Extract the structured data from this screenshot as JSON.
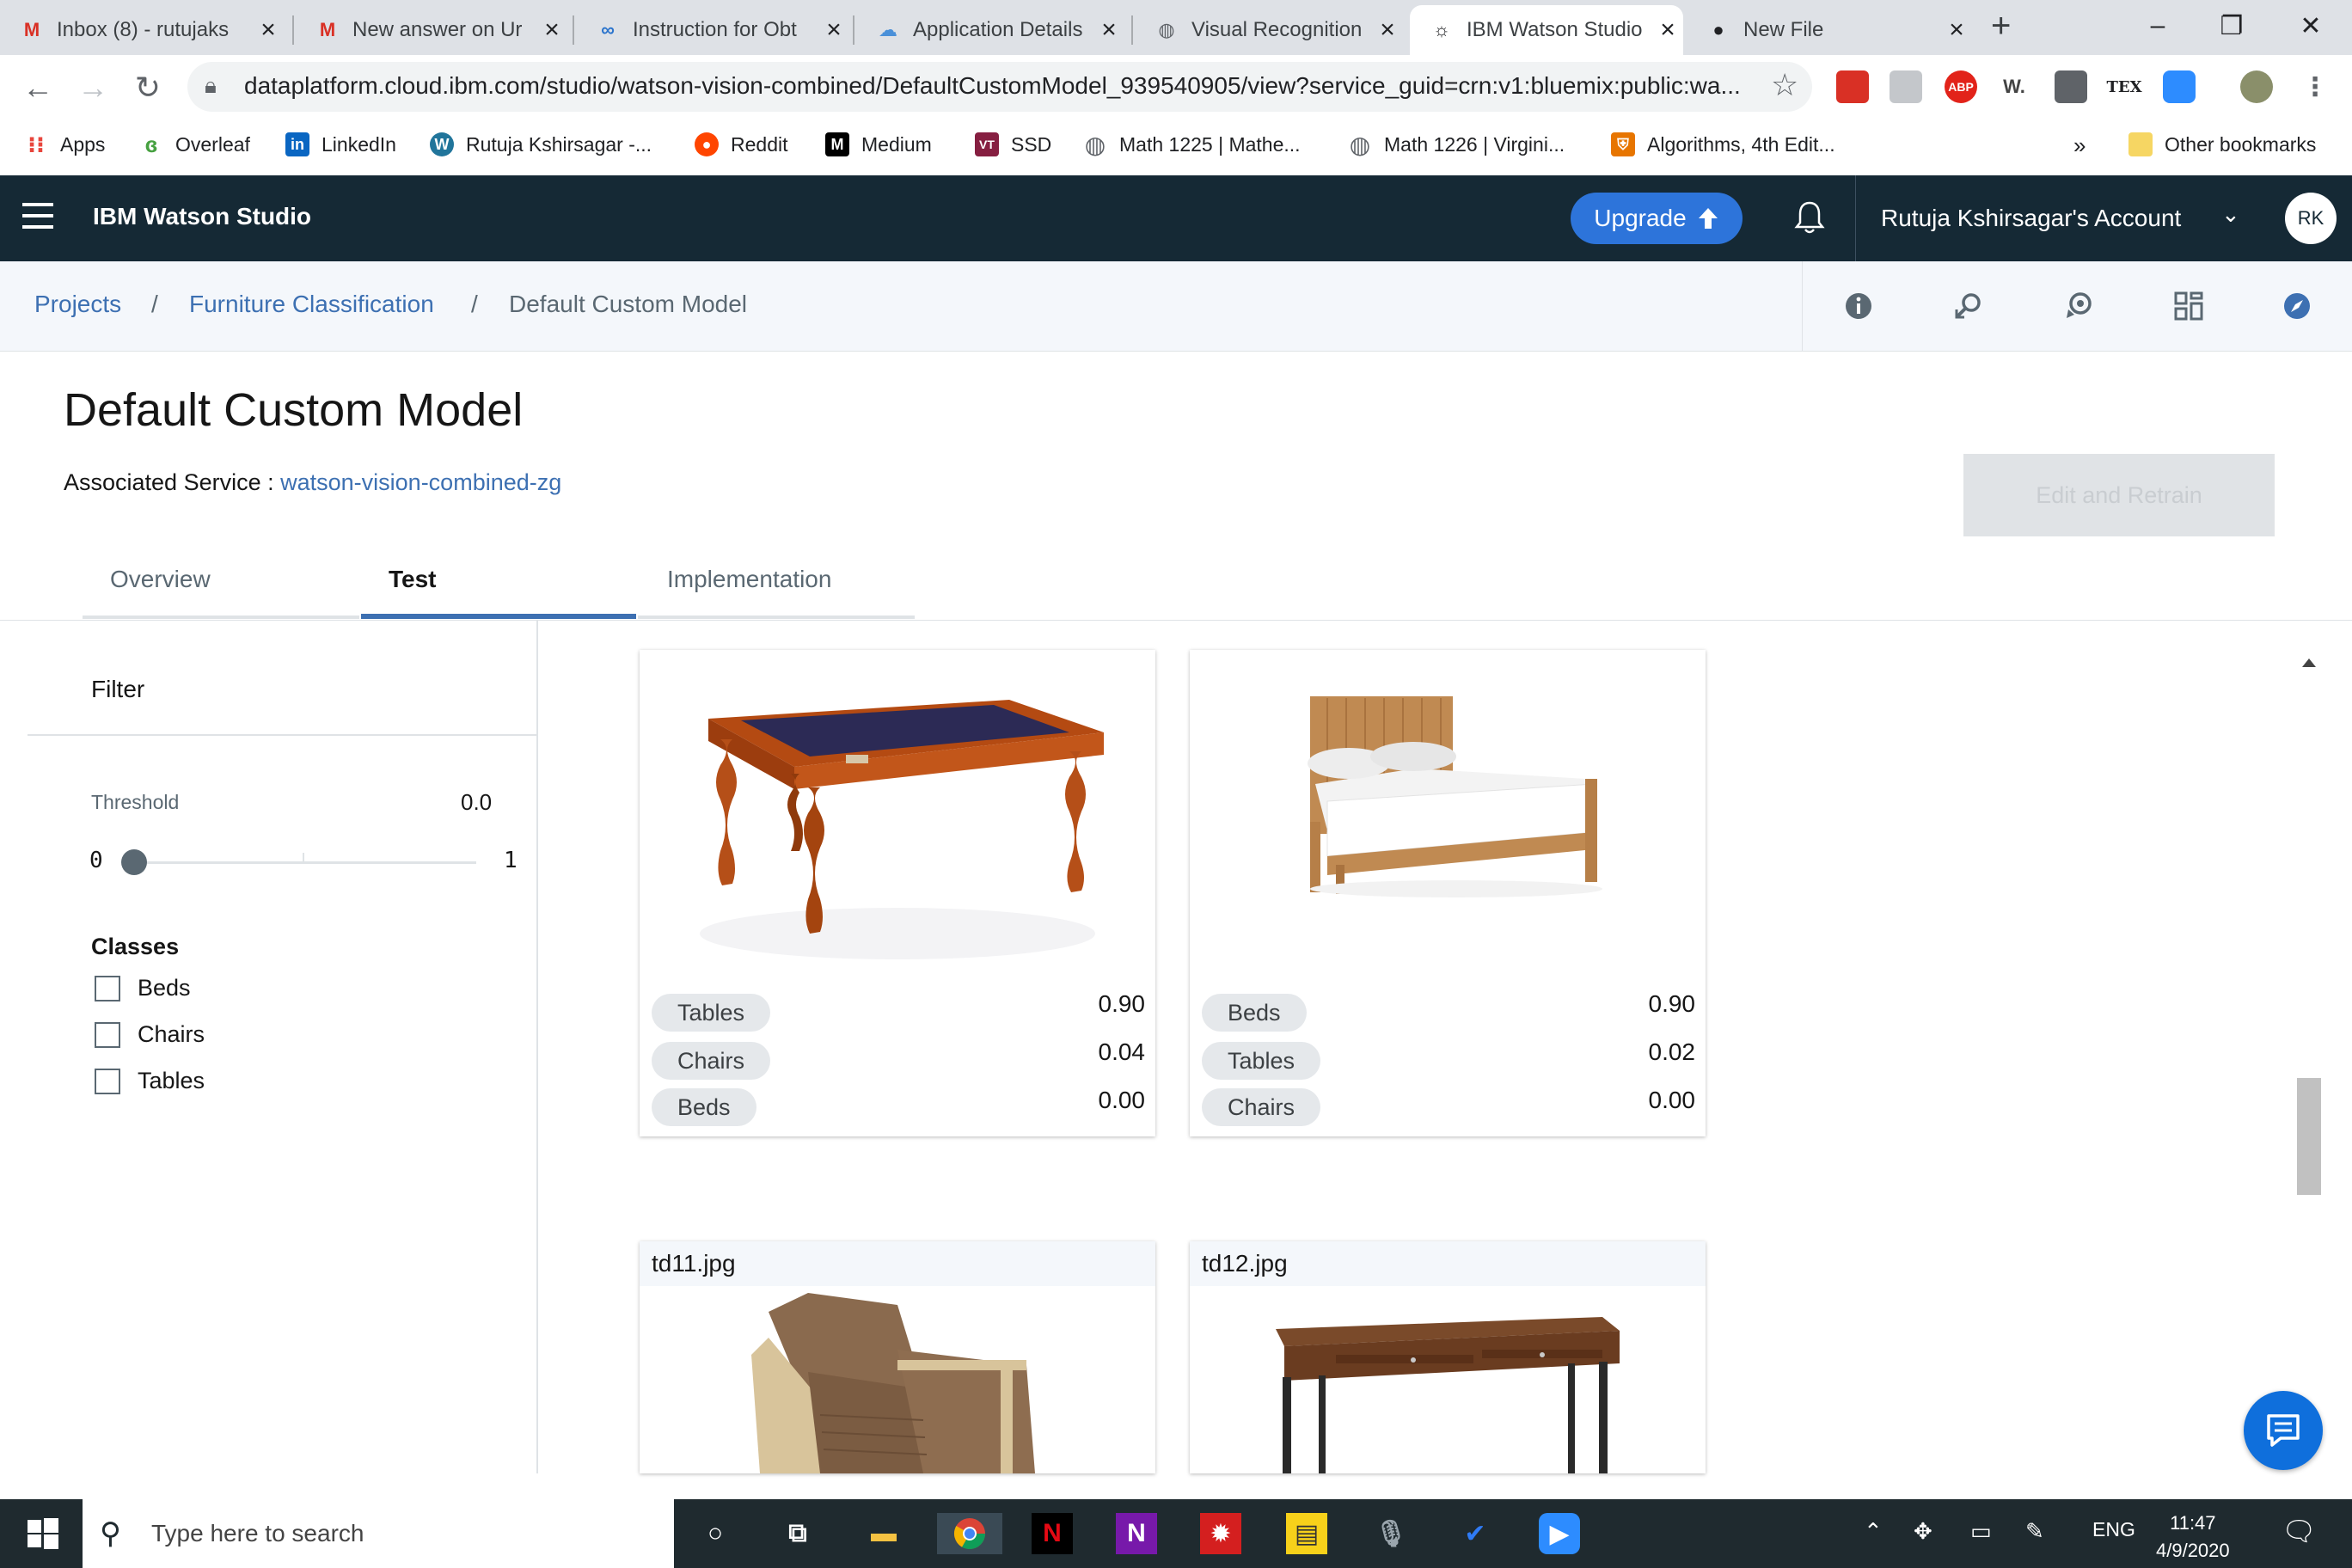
{
  "browser": {
    "tabs": [
      {
        "label": "Inbox (8) - rutujaks",
        "icon": "gmail-icon"
      },
      {
        "label": "New answer on Ur",
        "icon": "gmail-icon"
      },
      {
        "label": "Instruction for Obt",
        "icon": "coursera-icon"
      },
      {
        "label": "Application Details",
        "icon": "cloud-icon"
      },
      {
        "label": "Visual Recognition",
        "icon": "globe-icon"
      },
      {
        "label": "IBM Watson Studio",
        "icon": "watson-icon"
      },
      {
        "label": "New File",
        "icon": "github-icon"
      }
    ],
    "active_tab": 5,
    "url": "dataplatform.cloud.ibm.com/studio/watson-vision-combined/DefaultCustomModel_939540905/view?service_guid=crn:v1:bluemix:public:wa...",
    "extensions": [
      "ABP",
      "W.",
      "TEX"
    ],
    "bookmarks": [
      {
        "label": "Apps",
        "icon": "apps-grid-icon"
      },
      {
        "label": "Overleaf",
        "icon": "overleaf-icon"
      },
      {
        "label": "LinkedIn",
        "icon": "linkedin-icon"
      },
      {
        "label": "Rutuja Kshirsagar -...",
        "icon": "wordpress-icon"
      },
      {
        "label": "Reddit",
        "icon": "reddit-icon"
      },
      {
        "label": "Medium",
        "icon": "medium-icon"
      },
      {
        "label": "SSD",
        "icon": "vt-icon"
      },
      {
        "label": "Math 1225 | Mathe...",
        "icon": "globe-icon"
      },
      {
        "label": "Math 1226 | Virgini...",
        "icon": "globe-icon"
      },
      {
        "label": "Algorithms, 4th Edit...",
        "icon": "princeton-icon"
      }
    ],
    "bookmarks_overflow": "»",
    "other_bookmarks": "Other bookmarks"
  },
  "app": {
    "brand": "IBM Watson Studio",
    "upgrade_label": "Upgrade",
    "account_label": "Rutuja Kshirsagar's Account",
    "avatar_initials": "RK"
  },
  "breadcrumb": {
    "items": [
      "Projects",
      "Furniture Classification",
      "Default Custom Model"
    ],
    "separator": "/"
  },
  "page": {
    "title": "Default Custom Model",
    "associated_label": "Associated Service :",
    "associated_service": "watson-vision-combined-zg",
    "retrain_label": "Edit and Retrain",
    "tabs": [
      "Overview",
      "Test",
      "Implementation"
    ],
    "active_tab": "Test"
  },
  "filter": {
    "title": "Filter",
    "threshold_label": "Threshold",
    "threshold_value": "0.0",
    "slider_min": "0",
    "slider_max": "1",
    "slider_level": 0.0,
    "classes_title": "Classes",
    "classes": [
      "Beds",
      "Chairs",
      "Tables"
    ]
  },
  "results": [
    {
      "image": "coffee-table-photo",
      "scores": [
        {
          "class": "Tables",
          "score": "0.90"
        },
        {
          "class": "Chairs",
          "score": "0.04"
        },
        {
          "class": "Beds",
          "score": "0.00"
        }
      ]
    },
    {
      "image": "wooden-bed-photo",
      "scores": [
        {
          "class": "Beds",
          "score": "0.90"
        },
        {
          "class": "Tables",
          "score": "0.02"
        },
        {
          "class": "Chairs",
          "score": "0.00"
        }
      ]
    },
    {
      "filename": "td11.jpg",
      "image": "armchair-photo"
    },
    {
      "filename": "td12.jpg",
      "image": "writing-desk-photo"
    }
  ],
  "taskbar": {
    "search_placeholder": "Type here to search",
    "language": "ENG",
    "time": "11:47",
    "date": "4/9/2020"
  },
  "colors": {
    "header_bg": "#152935",
    "accent": "#3d70b2",
    "upgrade": "#2d74da",
    "chat_fab": "#0f6fdc"
  }
}
